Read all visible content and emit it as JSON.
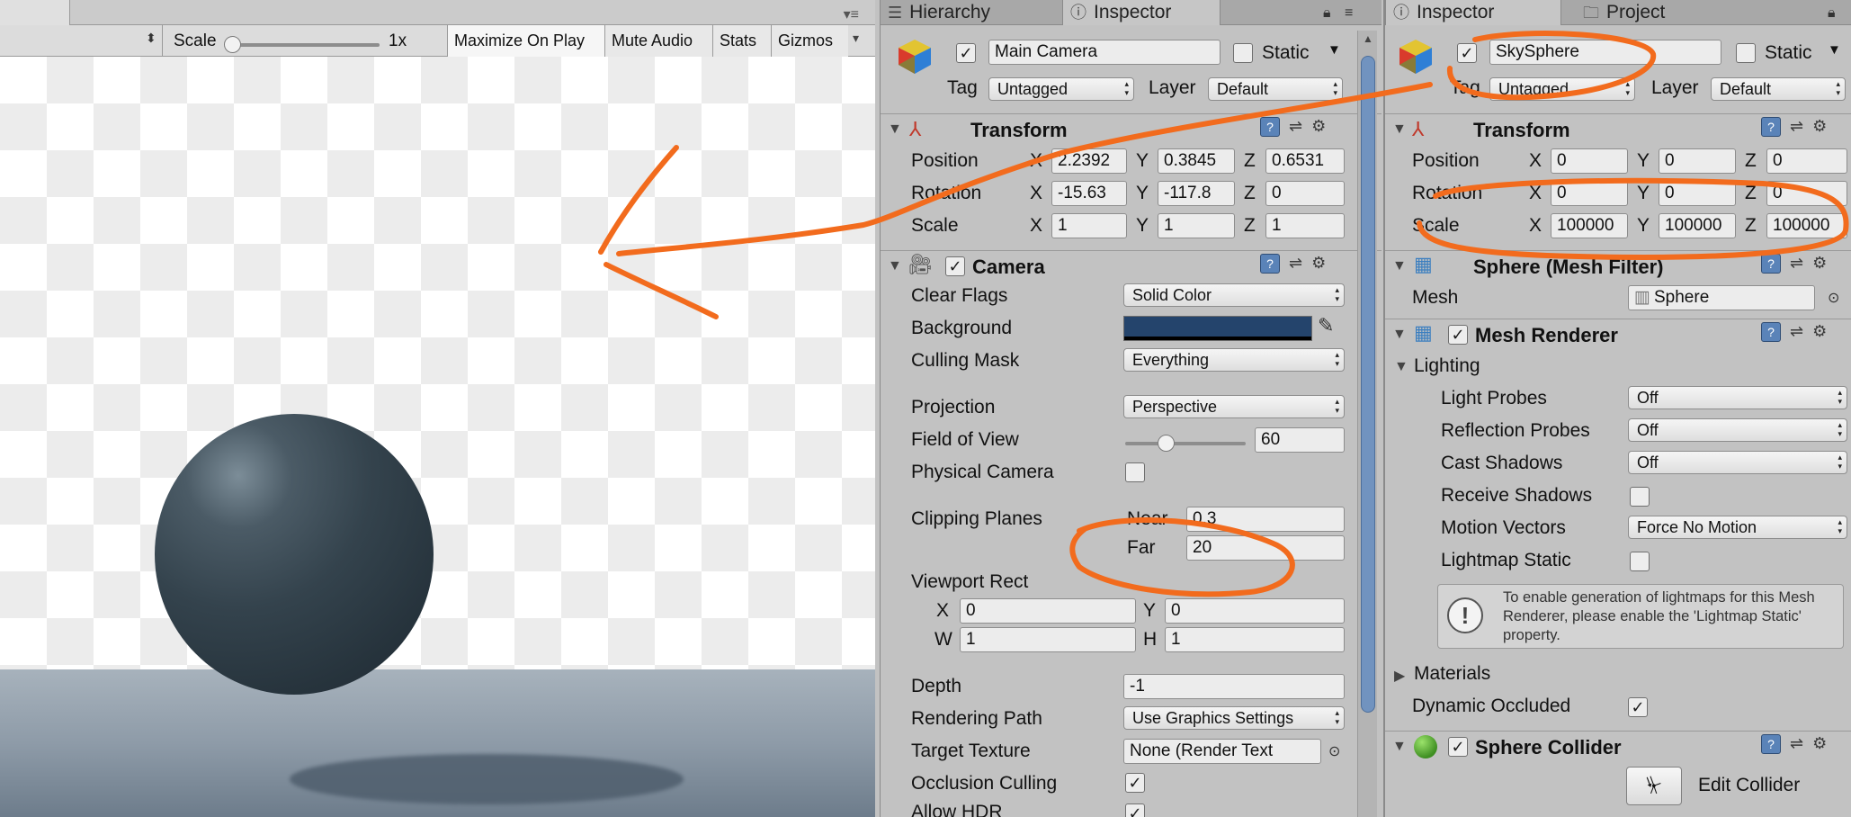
{
  "game": {
    "scale_label": "Scale",
    "scale_value": "1x",
    "buttons": [
      "Maximize On Play",
      "Mute Audio",
      "Stats",
      "Gizmos"
    ]
  },
  "panel1": {
    "tabs": [
      "Hierarchy",
      "Inspector"
    ],
    "object": {
      "name": "Main Camera",
      "static_label": "Static",
      "tag_label": "Tag",
      "tag_value": "Untagged",
      "layer_label": "Layer",
      "layer_value": "Default"
    },
    "transform": {
      "title": "Transform",
      "position_label": "Position",
      "position": [
        "2.2392",
        "0.3845",
        "0.6531"
      ],
      "rotation_label": "Rotation",
      "rotation": [
        "-15.63",
        "-117.8",
        "0"
      ],
      "scale_label": "Scale",
      "scale": [
        "1",
        "1",
        "1"
      ]
    },
    "camera": {
      "title": "Camera",
      "clear_flags_label": "Clear Flags",
      "clear_flags": "Solid Color",
      "background_label": "Background",
      "culling_mask_label": "Culling Mask",
      "culling_mask": "Everything",
      "projection_label": "Projection",
      "projection": "Perspective",
      "fov_label": "Field of View",
      "fov": "60",
      "physical_label": "Physical Camera",
      "clipping_label": "Clipping Planes",
      "near_label": "Near",
      "near": "0.3",
      "far_label": "Far",
      "far": "20",
      "viewport_label": "Viewport Rect",
      "vx": "0",
      "vy": "0",
      "vw": "1",
      "vh": "1",
      "depth_label": "Depth",
      "depth": "-1",
      "rendering_label": "Rendering Path",
      "rendering": "Use Graphics Settings",
      "target_label": "Target Texture",
      "target": "None (Render Text",
      "occlusion_label": "Occlusion Culling",
      "hdr_label": "Allow HDR"
    },
    "axes": [
      "X",
      "Y",
      "Z"
    ],
    "viewport_axes": [
      "X",
      "Y",
      "W",
      "H"
    ]
  },
  "panel2": {
    "tabs": [
      "Inspector",
      "Project"
    ],
    "object": {
      "name": "SkySphere",
      "static_label": "Static",
      "tag_label": "Tag",
      "tag_value": "Untagged",
      "layer_label": "Layer",
      "layer_value": "Default"
    },
    "transform": {
      "title": "Transform",
      "position_label": "Position",
      "position": [
        "0",
        "0",
        "0"
      ],
      "rotation_label": "Rotation",
      "rotation": [
        "0",
        "0",
        "0"
      ],
      "scale_label": "Scale",
      "scale": [
        "100000",
        "100000",
        "100000"
      ]
    },
    "mesh_filter": {
      "title": "Sphere (Mesh Filter)",
      "mesh_label": "Mesh",
      "mesh": "Sphere"
    },
    "mesh_renderer": {
      "title": "Mesh Renderer",
      "lighting_label": "Lighting",
      "light_probes_label": "Light Probes",
      "light_probes": "Off",
      "reflection_label": "Reflection Probes",
      "reflection": "Off",
      "cast_label": "Cast Shadows",
      "cast": "Off",
      "receive_label": "Receive Shadows",
      "motion_label": "Motion Vectors",
      "motion": "Force No Motion",
      "lightmap_label": "Lightmap Static",
      "help": "To enable generation of lightmaps for this Mesh Renderer, please enable the 'Lightmap Static' property.",
      "materials_label": "Materials",
      "dynamic_label": "Dynamic Occluded"
    },
    "collider": {
      "title": "Sphere Collider",
      "edit_label": "Edit Collider"
    }
  },
  "colors": {
    "annotation": "#f26b1d",
    "camera_background": "#24446c",
    "accent": "#5a83b8"
  }
}
